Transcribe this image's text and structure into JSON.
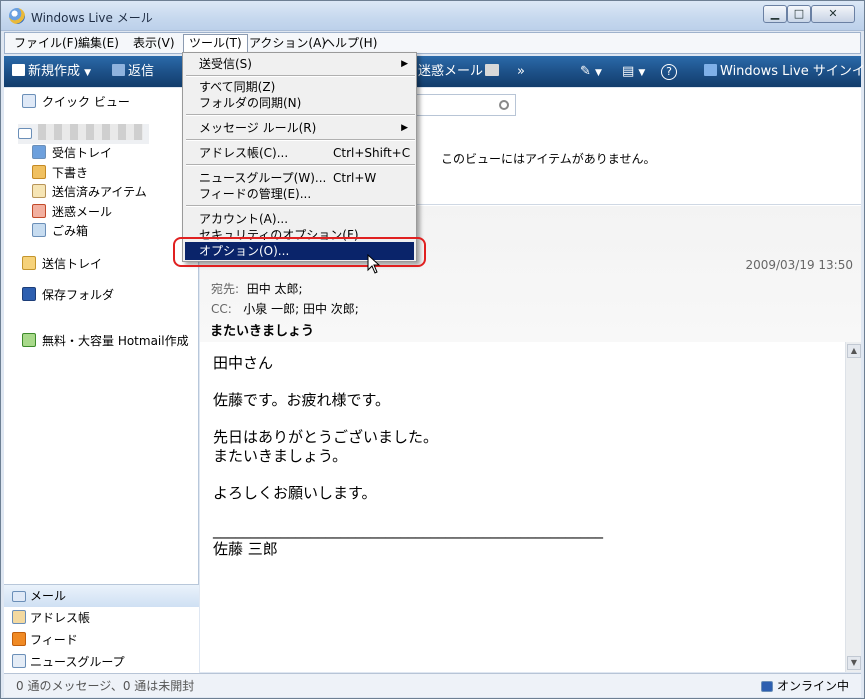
{
  "window": {
    "title": "Windows Live メール",
    "min": "▁",
    "max": "□",
    "close": "✕"
  },
  "menubar": [
    "ファイル(F)",
    "編集(E)",
    "表示(V)",
    "ツール(T)",
    "アクション(A)",
    "ヘルプ(H)"
  ],
  "toolbar": {
    "new": "新規作成",
    "reply": "返信",
    "junk": "迷惑メール",
    "more": "»",
    "signin": "Windows Live サインイン",
    "help": "?"
  },
  "sidebar": {
    "quick_views": "クイック ビュー",
    "folders": [
      "受信トレイ",
      "下書き",
      "送信済みアイテム",
      "迷惑メール",
      "ごみ箱"
    ],
    "outbox": "送信トレイ",
    "storage": "保存フォルダ",
    "hotmail": "無料・大容量 Hotmail作成"
  },
  "nav": [
    "メール",
    "アドレス帳",
    "フィード",
    "ニュースグループ"
  ],
  "content": {
    "empty_msg": "このビューにはアイテムがありません。",
    "date": "2009/03/19 13:50",
    "to_label": "宛先:",
    "to_value": "田中 太郎;",
    "cc_label": "CC:",
    "cc_value": "小泉 一郎; 田中 次郎;",
    "subject": "またいきましょう",
    "body": [
      "田中さん",
      "佐藤です。お疲れ様です。",
      "先日はありがとうございました。\nまたいきましょう。",
      "よろしくお願いします。",
      "____________________________________________________\n佐藤 三郎"
    ]
  },
  "tools_menu": [
    {
      "label": "送受信(S)",
      "submenu": true
    },
    {
      "label": "すべて同期(Z)"
    },
    {
      "label": "フォルダの同期(N)"
    },
    {
      "label": "メッセージ ルール(R)",
      "submenu": true
    },
    {
      "label": "アドレス帳(C)...",
      "shortcut": "Ctrl+Shift+C"
    },
    {
      "label": "ニュースグループ(W)...",
      "shortcut": "Ctrl+W"
    },
    {
      "label": "フィードの管理(E)..."
    },
    {
      "label": "アカウント(A)..."
    },
    {
      "label": "セキュリティのオプション(F)..."
    },
    {
      "label": "オプション(O)..."
    }
  ],
  "status": {
    "left": "0 通のメッセージ、0 通は未開封",
    "right": "オンライン中"
  },
  "colors": {
    "highlight": "#0a246a",
    "callout": "#e02020",
    "toolbar": "#1c4f86"
  }
}
